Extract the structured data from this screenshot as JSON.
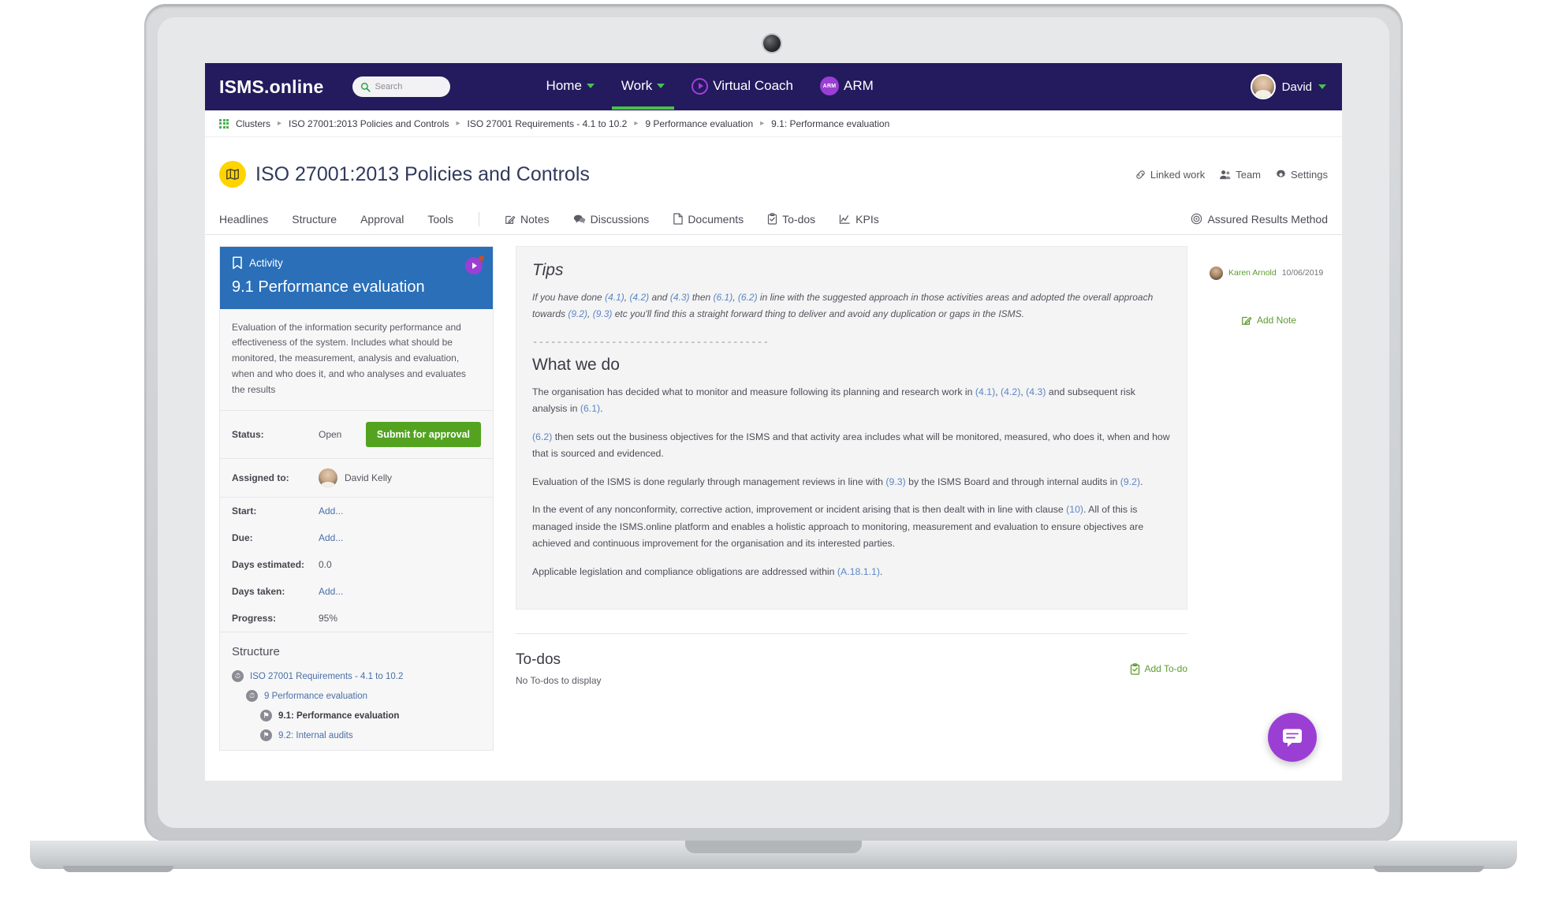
{
  "header": {
    "brand": "ISMS.online",
    "search": {
      "placeholder": "Search",
      "icon": "search-icon"
    },
    "nav": [
      {
        "label": "Home",
        "icon": "chevron-down-icon",
        "active": false
      },
      {
        "label": "Work",
        "icon": "chevron-down-icon",
        "active": true
      },
      {
        "label": "Virtual Coach",
        "icon": "play-circle-icon",
        "active": false
      },
      {
        "label": "ARM",
        "icon": "arm-badge-icon",
        "active": false
      }
    ],
    "arm_badge_text": "ARM",
    "user": {
      "name": "David",
      "icon": "avatar",
      "caret": "chevron-down-icon"
    }
  },
  "breadcrumb": {
    "icon": "clusters-grid-icon",
    "items": [
      "Clusters",
      "ISO 27001:2013 Policies and Controls",
      "ISO 27001 Requirements - 4.1 to 10.2",
      "9 Performance evaluation",
      "9.1: Performance evaluation"
    ],
    "separator": "▸"
  },
  "page": {
    "title": "ISO 27001:2013 Policies and Controls",
    "title_icon": "map-icon",
    "actions": [
      {
        "label": "Linked work",
        "icon": "link-icon"
      },
      {
        "label": "Team",
        "icon": "people-icon"
      },
      {
        "label": "Settings",
        "icon": "gear-icon"
      }
    ]
  },
  "tabs": {
    "left": [
      {
        "label": "Headlines",
        "icon": null
      },
      {
        "label": "Structure",
        "icon": null
      },
      {
        "label": "Approval",
        "icon": null
      },
      {
        "label": "Tools",
        "icon": null
      }
    ],
    "right_group": [
      {
        "label": "Notes",
        "icon": "pencil-square-icon"
      },
      {
        "label": "Discussions",
        "icon": "comments-icon"
      },
      {
        "label": "Documents",
        "icon": "document-icon"
      },
      {
        "label": "To-dos",
        "icon": "clipboard-check-icon"
      },
      {
        "label": "KPIs",
        "icon": "chart-line-icon"
      }
    ],
    "far_right": {
      "label": "Assured Results Method",
      "icon": "target-icon"
    }
  },
  "activity": {
    "card_label": "Activity",
    "card_label_icon": "bookmark-icon",
    "coach_icon": "virtual-coach-icon",
    "title": "9.1 Performance evaluation",
    "description": "Evaluation of the information security performance and effectiveness of the system. Includes what should be monitored, the measurement, analysis and evaluation, when and who does it, and who analyses and evaluates the results",
    "status_label": "Status:",
    "status_value": "Open",
    "submit_label": "Submit for approval",
    "fields": [
      {
        "label": "Assigned to:",
        "value": "David Kelly",
        "is_link": false,
        "has_avatar": true
      },
      {
        "label": "Start:",
        "value": "Add...",
        "is_link": true,
        "has_avatar": false
      },
      {
        "label": "Due:",
        "value": "Add...",
        "is_link": true,
        "has_avatar": false
      },
      {
        "label": "Days estimated:",
        "value": "0.0",
        "is_link": false,
        "has_avatar": false
      },
      {
        "label": "Days taken:",
        "value": "Add...",
        "is_link": true,
        "has_avatar": false
      },
      {
        "label": "Progress:",
        "value": "95%",
        "is_link": false,
        "has_avatar": false
      }
    ],
    "structure_title": "Structure",
    "structure_tree": [
      {
        "label": "ISO 27001 Requirements - 4.1 to 10.2",
        "depth": 0,
        "icon": "clock-icon",
        "current": false
      },
      {
        "label": "9 Performance evaluation",
        "depth": 1,
        "icon": "clock-icon",
        "current": false
      },
      {
        "label": "9.1: Performance evaluation",
        "depth": 2,
        "icon": "bookmark-circle-icon",
        "current": true
      },
      {
        "label": "9.2: Internal audits",
        "depth": 2,
        "icon": "bookmark-circle-icon",
        "current": false
      }
    ]
  },
  "tips": {
    "heading": "Tips",
    "text_parts": [
      {
        "t": "If you have done ",
        "ref": false
      },
      {
        "t": "(4.1)",
        "ref": true
      },
      {
        "t": ", ",
        "ref": false
      },
      {
        "t": "(4.2)",
        "ref": true
      },
      {
        "t": " and ",
        "ref": false
      },
      {
        "t": "(4.3)",
        "ref": true
      },
      {
        "t": " then ",
        "ref": false
      },
      {
        "t": "(6.1)",
        "ref": true
      },
      {
        "t": ", ",
        "ref": false
      },
      {
        "t": "(6.2)",
        "ref": true
      },
      {
        "t": " in line with the suggested approach in those activities areas and adopted the overall approach towards ",
        "ref": false
      },
      {
        "t": "(9.2)",
        "ref": true
      },
      {
        "t": ", ",
        "ref": false
      },
      {
        "t": "(9.3)",
        "ref": true
      },
      {
        "t": " etc you'll find this a straight forward thing to deliver and avoid any duplication or gaps in the ISMS.",
        "ref": false
      }
    ],
    "divider": "---------------------------------------",
    "what_we_do_heading": "What we do",
    "paragraphs": [
      [
        {
          "t": "The organisation has decided what to monitor and measure following its planning and research work in ",
          "ref": false
        },
        {
          "t": "(4.1)",
          "ref": true
        },
        {
          "t": ", ",
          "ref": false
        },
        {
          "t": "(4.2)",
          "ref": true
        },
        {
          "t": ", ",
          "ref": false
        },
        {
          "t": "(4.3)",
          "ref": true
        },
        {
          "t": " and subsequent risk analysis in ",
          "ref": false
        },
        {
          "t": "(6.1)",
          "ref": true
        },
        {
          "t": ".",
          "ref": false
        }
      ],
      [
        {
          "t": "(6.2)",
          "ref": true
        },
        {
          "t": " then sets out the business objectives for the ISMS and that activity area includes what will be monitored, measured, who does it, when and how that is sourced and evidenced.",
          "ref": false
        }
      ],
      [
        {
          "t": "Evaluation of the ISMS is done regularly through management reviews in line with ",
          "ref": false
        },
        {
          "t": "(9.3)",
          "ref": true
        },
        {
          "t": " by the ISMS Board and through internal audits in ",
          "ref": false
        },
        {
          "t": "(9.2)",
          "ref": true
        },
        {
          "t": ".",
          "ref": false
        }
      ],
      [
        {
          "t": "In the event of any nonconformity, corrective action, improvement or incident arising that is then dealt with in line with clause ",
          "ref": false
        },
        {
          "t": "(10)",
          "ref": true
        },
        {
          "t": ". All of this is managed inside the ISMS.online platform and enables a holistic approach to monitoring, measurement and evaluation to ensure objectives are achieved and continuous improvement for the organisation and its interested parties.",
          "ref": false
        }
      ],
      [
        {
          "t": "Applicable legislation and compliance obligations are addressed within ",
          "ref": false
        },
        {
          "t": "(A.18.1.1)",
          "ref": true
        },
        {
          "t": ".",
          "ref": false
        }
      ]
    ]
  },
  "notes_panel": {
    "note_author": "Karen Arnold",
    "note_date": "10/06/2019",
    "add_note_label": "Add Note",
    "add_note_icon": "pencil-square-icon"
  },
  "todos": {
    "heading": "To-dos",
    "empty_text": "No To-dos to display",
    "add_label": "Add To-do",
    "add_icon": "clipboard-check-icon"
  },
  "chat": {
    "icon": "chat-bubble-icon"
  },
  "colors": {
    "header_bg": "#241a5e",
    "accent_green": "#47c34b",
    "activity_blue": "#2a6fb8",
    "submit_green": "#53a320",
    "purple": "#9b3fd4",
    "title_navy": "#303a5c",
    "ref_blue": "#5b87c4",
    "badge_yellow": "#ffd400"
  }
}
